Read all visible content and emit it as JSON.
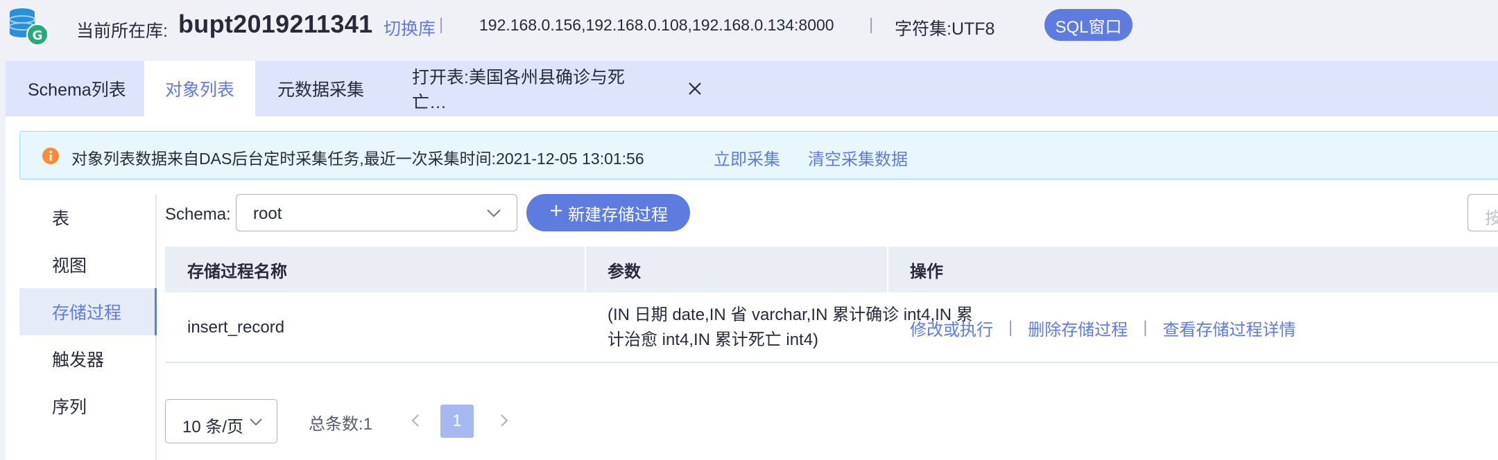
{
  "header": {
    "current_db_label": "当前所在库:",
    "db_name": "bupt2019211341",
    "switch_link": "切换库",
    "separator": "|",
    "hosts": "192.168.0.156,192.168.0.108,192.168.0.134:8000",
    "charset": "字符集:UTF8",
    "sql_window_button": "SQL窗口"
  },
  "tabs": [
    {
      "label": "Schema列表",
      "active": false
    },
    {
      "label": "对象列表",
      "active": true
    },
    {
      "label": "元数据采集",
      "active": false
    },
    {
      "label": "打开表:美国各州县确诊与死亡…",
      "active": false
    }
  ],
  "tab_close": "X",
  "notice": {
    "text": "对象列表数据来自DAS后台定时采集任务,最近一次采集时间:2021-12-05 13:01:56",
    "collect_now": "立即采集",
    "clear_data": "清空采集数据"
  },
  "sidebar": {
    "items": [
      {
        "label": "表",
        "active": false
      },
      {
        "label": "视图",
        "active": false
      },
      {
        "label": "存储过程",
        "active": true
      },
      {
        "label": "触发器",
        "active": false
      },
      {
        "label": "序列",
        "active": false
      }
    ]
  },
  "toolbar": {
    "schema_label": "Schema:",
    "schema_value": "root",
    "new_button": "新建存储过程",
    "search_placeholder": "按"
  },
  "table": {
    "columns": [
      "存储过程名称",
      "参数",
      "操作"
    ],
    "rows": [
      {
        "name": "insert_record",
        "params": "(IN 日期 date,IN 省 varchar,IN 累计确诊 int4,IN 累计治愈 int4,IN 累计死亡 int4)",
        "actions": [
          "修改或执行",
          "删除存储过程",
          "查看存储过程详情"
        ]
      }
    ],
    "action_separator": "|"
  },
  "pagination": {
    "page_size": "10 条/页",
    "total": "总条数:1",
    "current_page": "1"
  },
  "colors": {
    "accent": "#5e7ce0",
    "notice_bg": "#e8f6fe",
    "warning": "#fa8c3c"
  }
}
